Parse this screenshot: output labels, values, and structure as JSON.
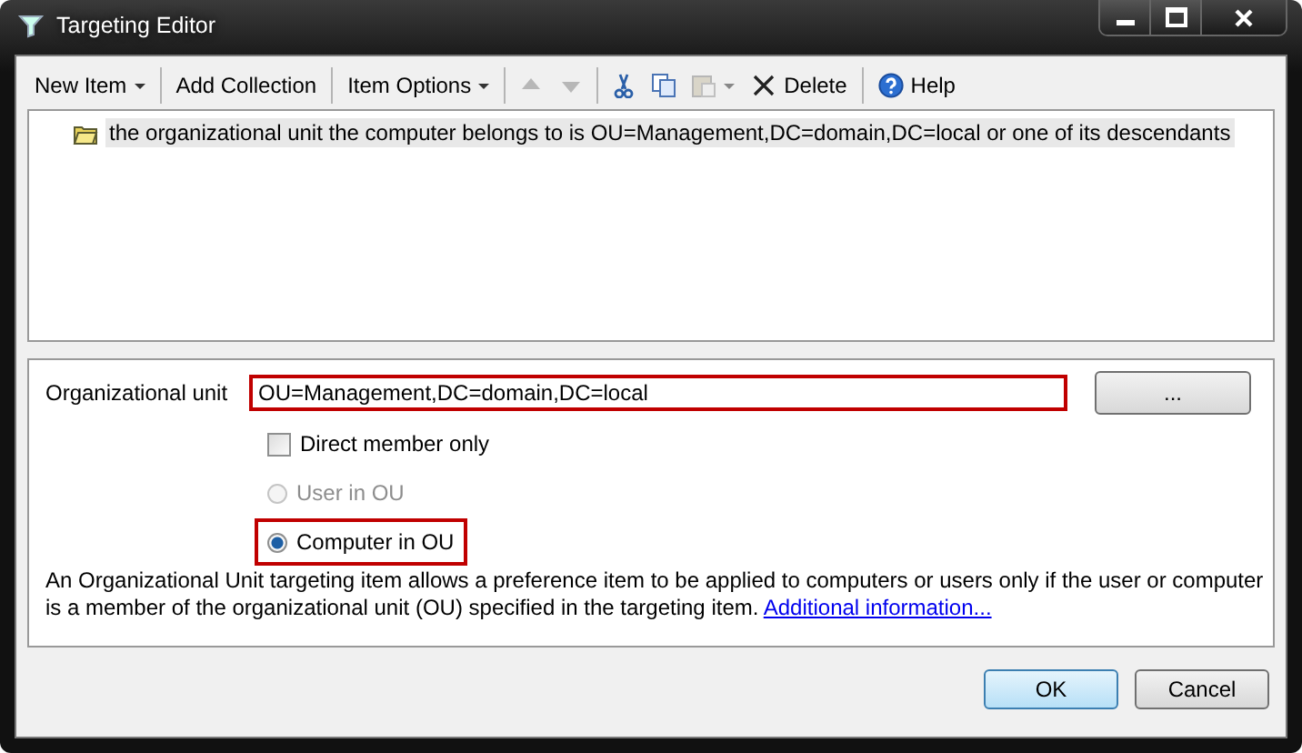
{
  "window": {
    "title": "Targeting Editor"
  },
  "toolbar": [
    {
      "kind": "menu",
      "label": "New Item",
      "disabled": false
    },
    {
      "kind": "button",
      "label": "Add Collection",
      "disabled": false
    },
    {
      "kind": "menu",
      "label": "Item Options",
      "disabled": false
    },
    {
      "kind": "up",
      "disabled": true
    },
    {
      "kind": "down",
      "disabled": true
    },
    {
      "kind": "cut",
      "disabled": false
    },
    {
      "kind": "copy",
      "disabled": false
    },
    {
      "kind": "paste",
      "disabled": true
    },
    {
      "kind": "delete",
      "label": "Delete",
      "disabled": false
    },
    {
      "kind": "help",
      "label": "Help",
      "disabled": false
    }
  ],
  "tree": {
    "items": [
      {
        "label": "the organizational unit the computer belongs to is OU=Management,DC=domain,DC=local or one of its descendants",
        "selected": true
      }
    ]
  },
  "details": {
    "ou_label": "Organizational unit",
    "ou_value": "OU=Management,DC=domain,DC=local",
    "ou_highlighted": true,
    "browse_button": "...",
    "direct_member": {
      "label": "Direct member only",
      "checked": false
    },
    "scope": [
      {
        "label": "User in OU",
        "selected": false,
        "disabled": true,
        "highlighted": false
      },
      {
        "label": "Computer in OU",
        "selected": true,
        "disabled": false,
        "highlighted": true
      }
    ],
    "description": "An Organizational Unit targeting item allows a preference item to be applied to computers or users only if the user or computer is a member of the organizational unit (OU) specified in the targeting item.",
    "link": "Additional information..."
  },
  "buttons": [
    {
      "label": "OK",
      "default": true
    },
    {
      "label": "Cancel",
      "default": false
    }
  ]
}
